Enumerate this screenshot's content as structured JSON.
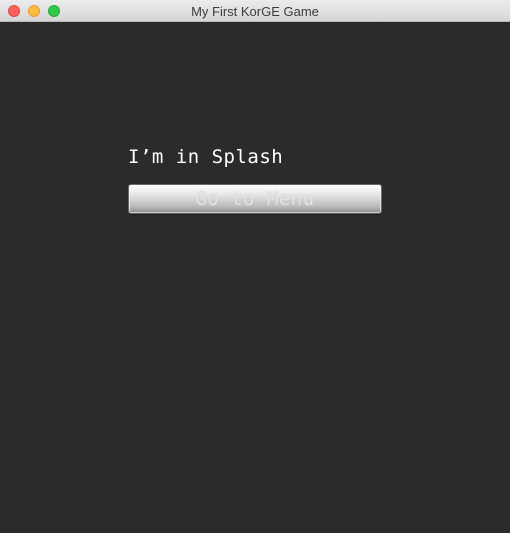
{
  "window": {
    "title": "My First KorGE Game"
  },
  "scene": {
    "label": "I’m in Splash",
    "button_label": "Go to Menu"
  }
}
